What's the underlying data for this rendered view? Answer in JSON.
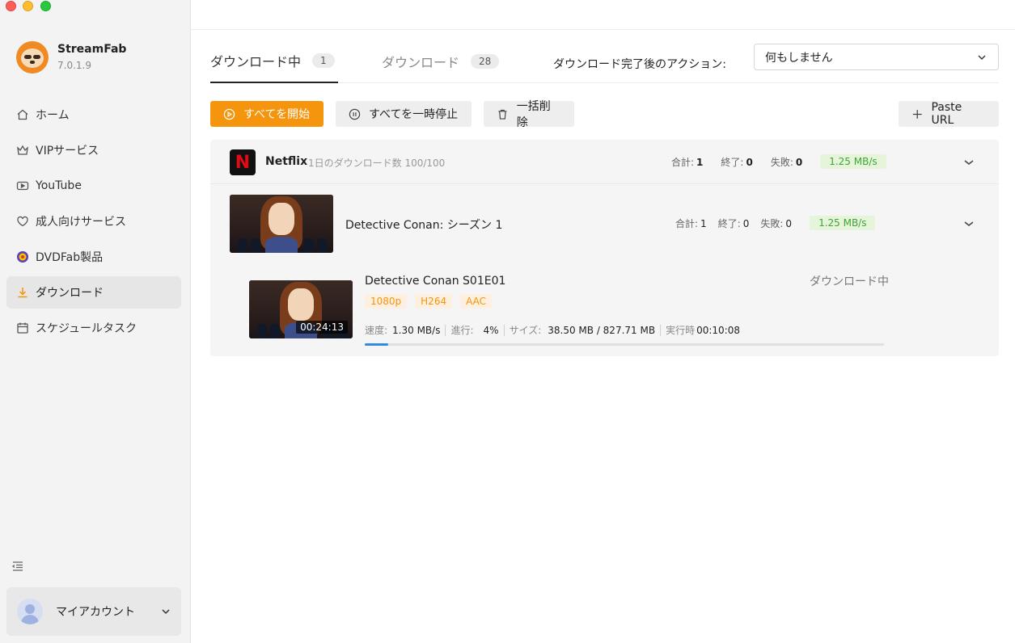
{
  "app": {
    "name": "StreamFab",
    "version": "7.0.1.9"
  },
  "sidebar": {
    "items": [
      {
        "label": "ホーム",
        "icon": "home-icon"
      },
      {
        "label": "VIPサービス",
        "icon": "crown-icon"
      },
      {
        "label": "YouTube",
        "icon": "youtube-icon"
      },
      {
        "label": "成人向けサービス",
        "icon": "heart-icon"
      },
      {
        "label": "DVDFab製品",
        "icon": "dvdfab-icon"
      },
      {
        "label": "ダウンロード",
        "icon": "download-icon",
        "active": true
      },
      {
        "label": "スケジュールタスク",
        "icon": "calendar-icon"
      }
    ],
    "account_label": "マイアカウント"
  },
  "tabs": [
    {
      "label": "ダウンロード中",
      "count": "1",
      "active": true
    },
    {
      "label": "ダウンロード",
      "count": "28",
      "active": false
    }
  ],
  "post_action": {
    "label": "ダウンロード完了後のアクション:",
    "selected": "何もしません"
  },
  "toolbar": {
    "start_all": "すべてを開始",
    "pause_all": "すべてを一時停止",
    "delete_all": "一括削除",
    "paste_url": "Paste URL"
  },
  "service": {
    "name": "Netflix",
    "quota": "1日のダウンロード数 100/100",
    "total_label": "合計:",
    "total": "1",
    "done_label": "終了:",
    "done": "0",
    "failed_label": "失敗:",
    "failed": "0",
    "speed": "1.25 MB/s"
  },
  "season": {
    "title": "Detective Conan: シーズン 1",
    "total_label": "合計:",
    "total": "1",
    "done_label": "終了:",
    "done": "0",
    "failed_label": "失敗:",
    "failed": "0",
    "speed": "1.25 MB/s"
  },
  "episode": {
    "title": "Detective Conan S01E01",
    "status": "ダウンロード中",
    "duration": "00:24:13",
    "tags": [
      "1080p",
      "H264",
      "AAC"
    ],
    "speed_label": "速度:",
    "speed": "1.30 MB/s",
    "progress_label": "進行:",
    "progress_text": "4%",
    "size_label": "サイズ:",
    "size": "38.50 MB / 827.71 MB",
    "elapsed_label": "実行時",
    "elapsed": "00:10:08",
    "progress": 0.045
  },
  "colors": {
    "accent": "#f5940d",
    "speed_green": "#3fa33a",
    "progress_blue": "#2f8be0",
    "netflix_red": "#e50914"
  }
}
